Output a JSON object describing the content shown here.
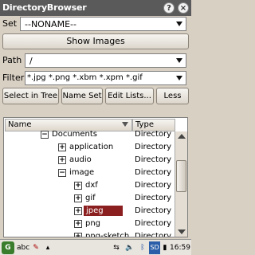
{
  "window": {
    "title": "DirectoryBrowser",
    "help_icon": "?",
    "close_icon": "×"
  },
  "set": {
    "label": "Set",
    "value": "--NONAME--"
  },
  "show_images_label": "Show Images",
  "path": {
    "label": "Path",
    "value": "/"
  },
  "filter": {
    "label": "Filter",
    "value": "*.jpg *.png *.xbm *.xpm *.gif"
  },
  "buttons": {
    "select_in_tree": "Select in Tree",
    "name_set": "Name Set",
    "edit_lists": "Edit Lists...",
    "less": "Less"
  },
  "tree": {
    "headers": {
      "name": "Name",
      "type": "Type"
    },
    "rows": [
      {
        "name": "Documents",
        "type": "Directory",
        "expander": "−"
      },
      {
        "name": "application",
        "type": "Directory",
        "expander": "+"
      },
      {
        "name": "audio",
        "type": "Directory",
        "expander": "+"
      },
      {
        "name": "image",
        "type": "Directory",
        "expander": "−"
      },
      {
        "name": "dxf",
        "type": "Directory",
        "expander": "+"
      },
      {
        "name": "gif",
        "type": "Directory",
        "expander": "+"
      },
      {
        "name": "jpeg",
        "type": "Directory",
        "expander": "+",
        "selected": true
      },
      {
        "name": "png",
        "type": "Directory",
        "expander": "+"
      },
      {
        "name": "png-sketch",
        "type": "Directory",
        "expander": "+"
      }
    ]
  },
  "taskbar": {
    "time": "16:59",
    "input_label": "abc",
    "sd_label": "SD"
  },
  "colors": {
    "titlebar": "#5a5a5a",
    "selection": "#8b1e1e",
    "background": "#d9d0c4"
  }
}
